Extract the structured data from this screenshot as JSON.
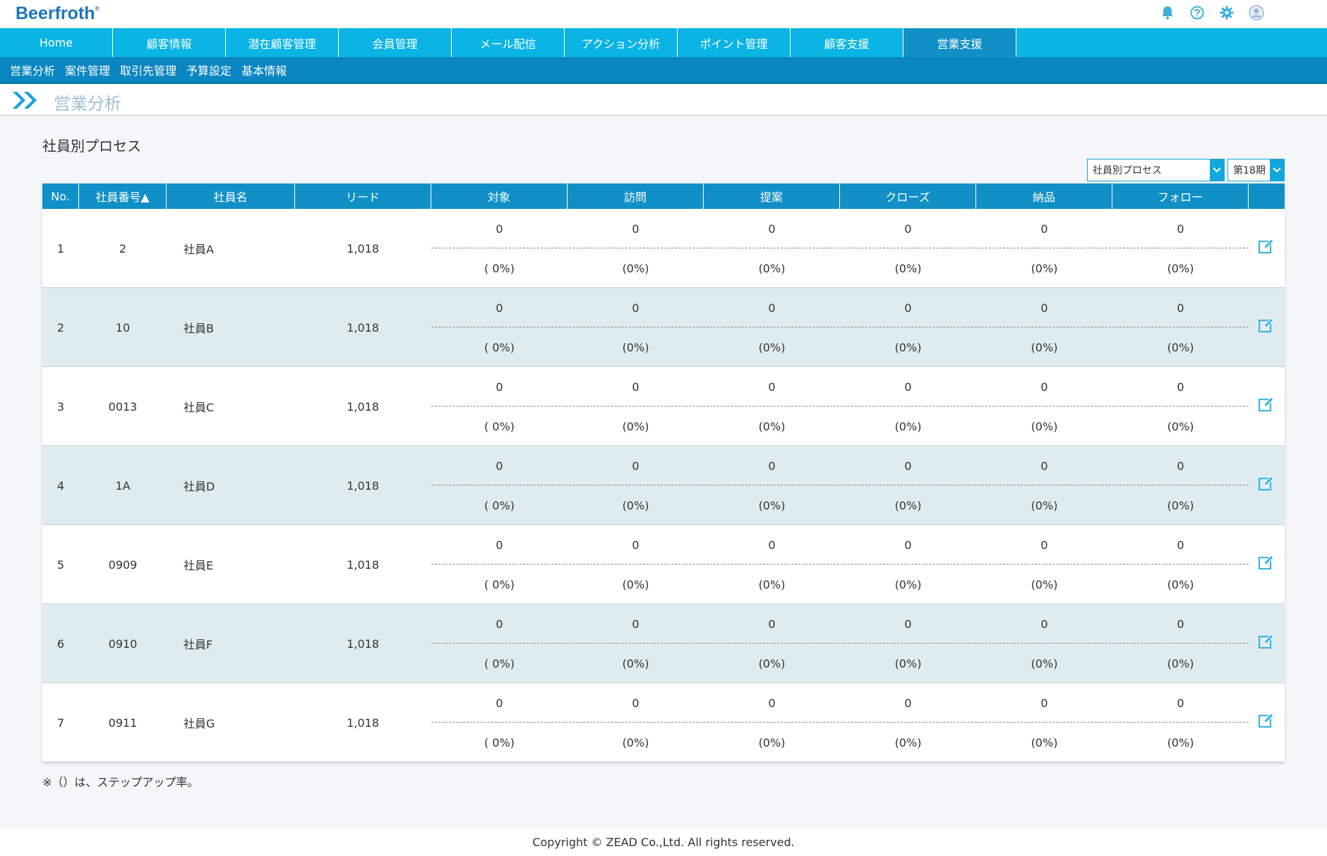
{
  "app": {
    "logo": "Beerfroth",
    "logo_mark": "®"
  },
  "top_icons": [
    "bell-icon",
    "help-icon",
    "gear-icon",
    "user-avatar-icon"
  ],
  "main_nav": {
    "items": [
      {
        "label": "Home"
      },
      {
        "label": "顧客情報"
      },
      {
        "label": "潜在顧客管理"
      },
      {
        "label": "会員管理"
      },
      {
        "label": "メール配信"
      },
      {
        "label": "アクション分析"
      },
      {
        "label": "ポイント管理"
      },
      {
        "label": "顧客支援"
      },
      {
        "label": "営業支援",
        "active": true
      }
    ]
  },
  "sub_nav": {
    "items": [
      {
        "label": "営業分析"
      },
      {
        "label": "案件管理"
      },
      {
        "label": "取引先管理"
      },
      {
        "label": "予算設定"
      },
      {
        "label": "基本情報"
      }
    ]
  },
  "page": {
    "title": "営業分析",
    "section_title": "社員別プロセス"
  },
  "filters": {
    "view_select": "社員別プロセス",
    "period_select": "第18期"
  },
  "table": {
    "headers": [
      "No.",
      "社員番号▲",
      "社員名",
      "リード",
      "対象",
      "訪問",
      "提案",
      "クローズ",
      "納品",
      "フォロー",
      ""
    ],
    "rows": [
      {
        "no": "1",
        "emp_no": "2",
        "name": "社員A",
        "lead": "1,018",
        "counts": [
          "0",
          "0",
          "0",
          "0",
          "0",
          "0"
        ],
        "rates": [
          "( 0%)",
          "(0%)",
          "(0%)",
          "(0%)",
          "(0%)",
          "(0%)"
        ]
      },
      {
        "no": "2",
        "emp_no": "10",
        "name": "社員B",
        "lead": "1,018",
        "counts": [
          "0",
          "0",
          "0",
          "0",
          "0",
          "0"
        ],
        "rates": [
          "( 0%)",
          "(0%)",
          "(0%)",
          "(0%)",
          "(0%)",
          "(0%)"
        ]
      },
      {
        "no": "3",
        "emp_no": "0013",
        "name": "社員C",
        "lead": "1,018",
        "counts": [
          "0",
          "0",
          "0",
          "0",
          "0",
          "0"
        ],
        "rates": [
          "( 0%)",
          "(0%)",
          "(0%)",
          "(0%)",
          "(0%)",
          "(0%)"
        ]
      },
      {
        "no": "4",
        "emp_no": "1A",
        "name": "社員D",
        "lead": "1,018",
        "counts": [
          "0",
          "0",
          "0",
          "0",
          "0",
          "0"
        ],
        "rates": [
          "( 0%)",
          "(0%)",
          "(0%)",
          "(0%)",
          "(0%)",
          "(0%)"
        ]
      },
      {
        "no": "5",
        "emp_no": "0909",
        "name": "社員E",
        "lead": "1,018",
        "counts": [
          "0",
          "0",
          "0",
          "0",
          "0",
          "0"
        ],
        "rates": [
          "( 0%)",
          "(0%)",
          "(0%)",
          "(0%)",
          "(0%)",
          "(0%)"
        ]
      },
      {
        "no": "6",
        "emp_no": "0910",
        "name": "社員F",
        "lead": "1,018",
        "counts": [
          "0",
          "0",
          "0",
          "0",
          "0",
          "0"
        ],
        "rates": [
          "( 0%)",
          "(0%)",
          "(0%)",
          "(0%)",
          "(0%)",
          "(0%)"
        ]
      },
      {
        "no": "7",
        "emp_no": "0911",
        "name": "社員G",
        "lead": "1,018",
        "counts": [
          "0",
          "0",
          "0",
          "0",
          "0",
          "0"
        ],
        "rates": [
          "( 0%)",
          "(0%)",
          "(0%)",
          "(0%)",
          "(0%)",
          "(0%)"
        ]
      }
    ]
  },
  "note": "※（）は、ステップアップ率。",
  "footer": "Copyright © ZEAD Co.,Ltd. All rights reserved.",
  "colors": {
    "nav": "#0ab4e4",
    "nav_active": "#1090c6",
    "subnav": "#0a86c2",
    "table_header": "#1090c6",
    "alt_row": "#dfecef",
    "edit_icon": "#3fb5e0"
  }
}
